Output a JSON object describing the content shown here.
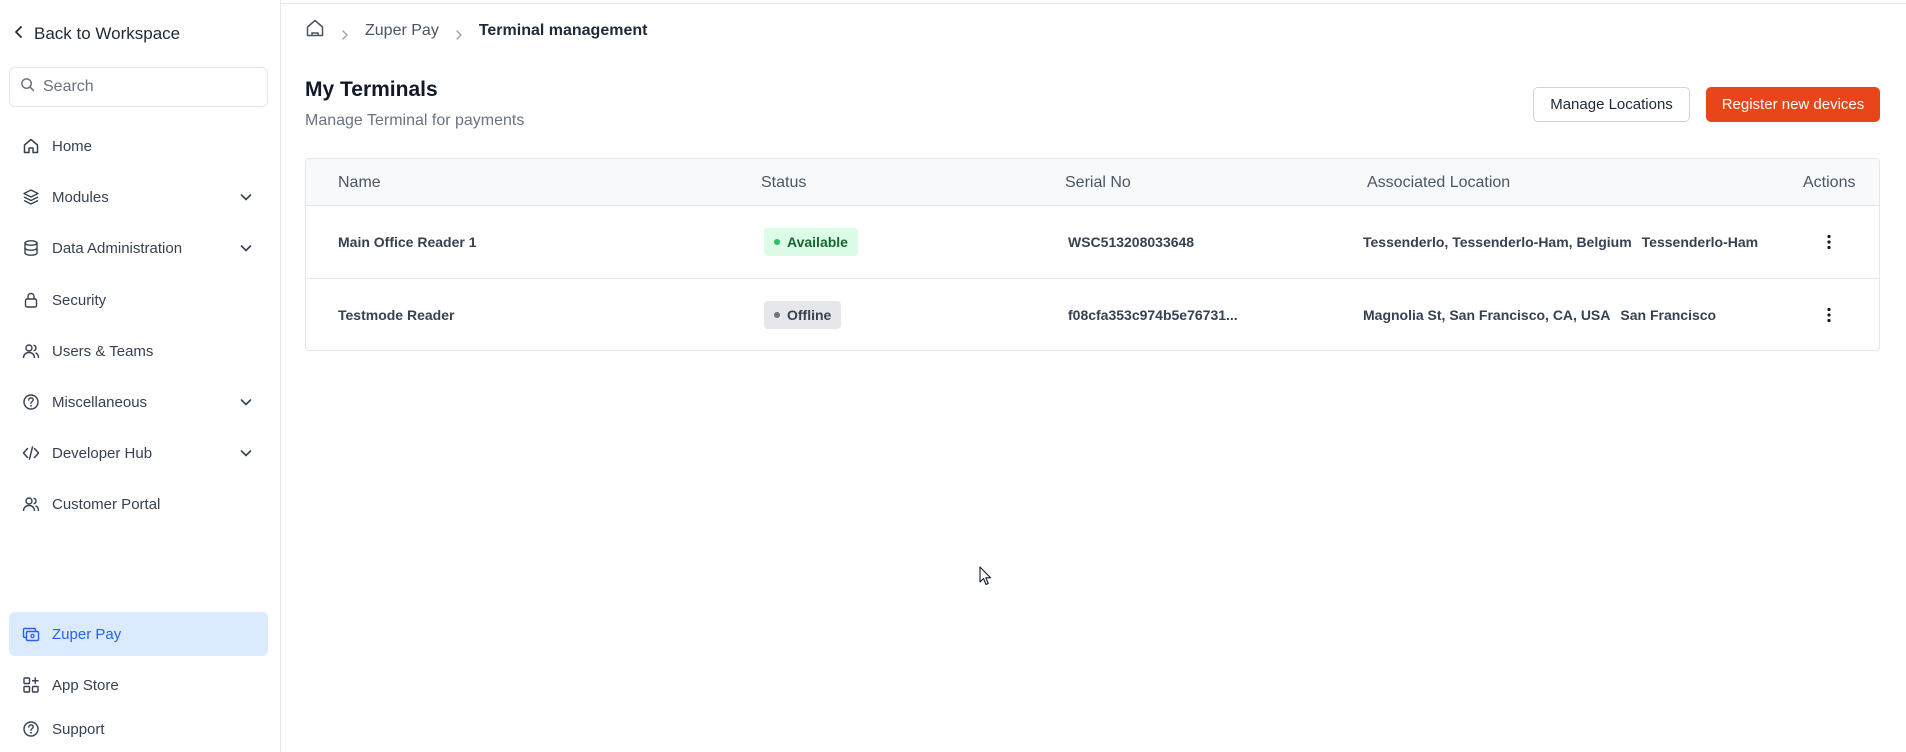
{
  "sidebar": {
    "back_label": "Back to Workspace",
    "search_placeholder": "Search",
    "items": [
      {
        "label": "Home",
        "icon": "home-icon",
        "expandable": false
      },
      {
        "label": "Modules",
        "icon": "layers-icon",
        "expandable": true
      },
      {
        "label": "Data Administration",
        "icon": "database-icon",
        "expandable": true
      },
      {
        "label": "Security",
        "icon": "lock-icon",
        "expandable": false
      },
      {
        "label": "Users & Teams",
        "icon": "users-icon",
        "expandable": false
      },
      {
        "label": "Miscellaneous",
        "icon": "help-circle-icon",
        "expandable": true
      },
      {
        "label": "Developer Hub",
        "icon": "code-icon",
        "expandable": true
      },
      {
        "label": "Customer Portal",
        "icon": "users-icon",
        "expandable": false
      }
    ],
    "bottom_items": [
      {
        "label": "Zuper Pay",
        "icon": "payment-icon",
        "active": true
      },
      {
        "label": "App Store",
        "icon": "grid-icon",
        "active": false
      },
      {
        "label": "Support",
        "icon": "help-circle-icon",
        "active": false
      }
    ]
  },
  "breadcrumb": {
    "parent": "Zuper Pay",
    "current": "Terminal management"
  },
  "page": {
    "title": "My Terminals",
    "subtitle": "Manage Terminal for payments",
    "manage_locations_label": "Manage Locations",
    "register_label": "Register new devices"
  },
  "table": {
    "columns": {
      "name": "Name",
      "status": "Status",
      "serial": "Serial No",
      "location": "Associated Location",
      "actions": "Actions"
    },
    "rows": [
      {
        "name": "Main Office Reader 1",
        "status": "Available",
        "serial": "WSC513208033648",
        "location": "Tessenderlo, Tessenderlo-Ham, Belgium",
        "city": "Tessenderlo-Ham"
      },
      {
        "name": "Testmode Reader",
        "status": "Offline",
        "serial": "f08cfa353c974b5e76731...",
        "location": "Magnolia St, San Francisco, CA, USA",
        "city": "San Francisco"
      }
    ]
  },
  "colors": {
    "accent": "#e8461a",
    "active_nav_bg": "#dbeafe",
    "active_nav_text": "#2563eb",
    "available": "#22c55e",
    "offline": "#6b7280"
  }
}
